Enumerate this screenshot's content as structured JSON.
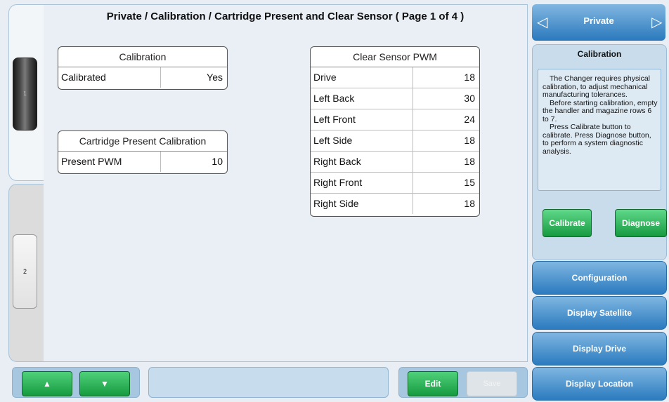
{
  "title": "Private / Calibration / Cartridge Present and Clear Sensor ( Page 1 of 4 )",
  "magazines": [
    {
      "label": "1"
    },
    {
      "label": "2"
    }
  ],
  "calibration_table": {
    "header": "Calibration",
    "rows": [
      {
        "label": "Calibrated",
        "value": "Yes"
      }
    ]
  },
  "cartridge_table": {
    "header": "Cartridge Present Calibration",
    "rows": [
      {
        "label": "Present PWM",
        "value": "10"
      }
    ]
  },
  "clear_sensor_table": {
    "header": "Clear Sensor PWM",
    "rows": [
      {
        "label": "Drive",
        "value": "18"
      },
      {
        "label": "Left Back",
        "value": "30"
      },
      {
        "label": "Left Front",
        "value": "24"
      },
      {
        "label": "Left Side",
        "value": "18"
      },
      {
        "label": "Right Back",
        "value": "18"
      },
      {
        "label": "Right Front",
        "value": "15"
      },
      {
        "label": "Right Side",
        "value": "18"
      }
    ]
  },
  "bottom_bar": {
    "up_icon": "▲",
    "down_icon": "▼",
    "edit_label": "Edit",
    "save_label": "Save"
  },
  "nav": {
    "title": "Private",
    "prev_icon": "◁",
    "next_icon": "▷"
  },
  "calibration_panel": {
    "title": "Calibration",
    "help": [
      "The Changer requires physical calibration, to adjust mechanical manufacturing tolerances.",
      "Before starting calibration, empty the handler and magazine rows 6 to 7.",
      "Press Calibrate button to calibrate.  Press Diagnose button, to perform a system diagnostic analysis."
    ],
    "calibrate_label": "Calibrate",
    "diagnose_label": "Diagnose"
  },
  "side_menu": [
    {
      "label": "Configuration"
    },
    {
      "label": "Display Satellite"
    },
    {
      "label": "Display Drive"
    },
    {
      "label": "Display Location"
    }
  ],
  "colors": {
    "accent_green": "#169a3f",
    "accent_blue": "#2b7bbf"
  }
}
